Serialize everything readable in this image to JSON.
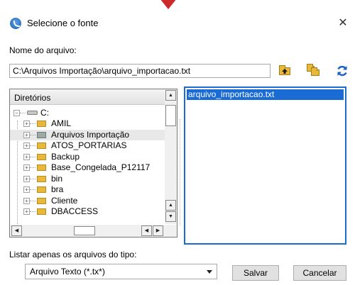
{
  "window": {
    "title": "Selecione o fonte",
    "close_glyph": "✕"
  },
  "file": {
    "label": "Nome do arquivo:",
    "path_value": "C:\\Arquivos Importação\\arquivo_importacao.txt"
  },
  "toolbar": {
    "icons": [
      "folder-up-icon",
      "folder-new-icon",
      "refresh-icon"
    ]
  },
  "directories": {
    "header": "Diretórios",
    "root": "C:",
    "items": [
      {
        "label": "AMIL",
        "icon": "folder-icon"
      },
      {
        "label": "Arquivos Importação",
        "icon": "folder-open-icon",
        "highlighted": true
      },
      {
        "label": "ATOS_PORTARIAS",
        "icon": "folder-icon"
      },
      {
        "label": "Backup",
        "icon": "folder-icon"
      },
      {
        "label": "Base_Congelada_P12117",
        "icon": "folder-icon"
      },
      {
        "label": "bin",
        "icon": "folder-icon"
      },
      {
        "label": "bra",
        "icon": "folder-icon"
      },
      {
        "label": "Cliente",
        "icon": "folder-icon"
      },
      {
        "label": "DBACCESS",
        "icon": "folder-icon"
      }
    ]
  },
  "files": {
    "items": [
      "arquivo_importacao.txt"
    ]
  },
  "filter": {
    "label": "Listar apenas os arquivos do tipo:",
    "selected": "Arquivo Texto (*.tx*)"
  },
  "buttons": {
    "save": "Salvar",
    "cancel": "Cancelar"
  },
  "colors": {
    "selection": "#1a6bd4",
    "folder": "#e8b83a",
    "marker": "#cc2a2a",
    "refresh": "#1a5fc8"
  }
}
